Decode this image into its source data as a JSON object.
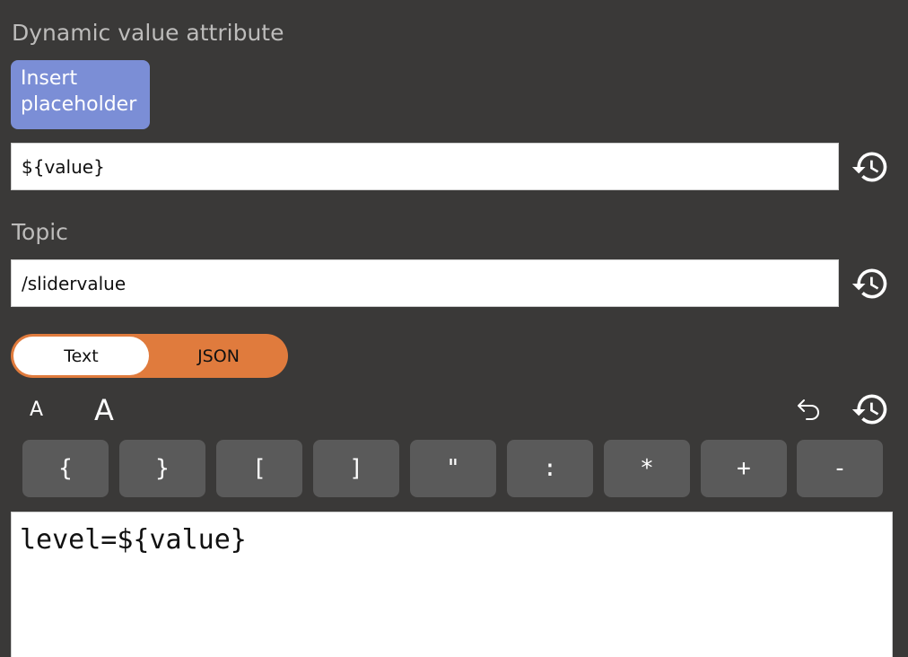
{
  "dynamic_value": {
    "label": "Dynamic value attribute",
    "insert_button_label": "Insert\nplaceholder",
    "input_value": "${value}"
  },
  "topic": {
    "label": "Topic",
    "input_value": "/slidervalue"
  },
  "format_toggle": {
    "options": [
      "Text",
      "JSON"
    ],
    "selected": "Text"
  },
  "font_controls": {
    "decrease_label": "A",
    "increase_label": "A"
  },
  "icons": {
    "history": "history-icon",
    "undo": "undo-icon"
  },
  "keys": [
    "{",
    "}",
    "[",
    "]",
    "\"",
    ":",
    "*",
    "+",
    "-"
  ],
  "editor": {
    "content": "level=${value}"
  },
  "colors": {
    "background": "#3a3938",
    "accent_blue": "#7b8ed6",
    "accent_orange": "#e07b3d",
    "key_background": "#5a5a5a"
  }
}
